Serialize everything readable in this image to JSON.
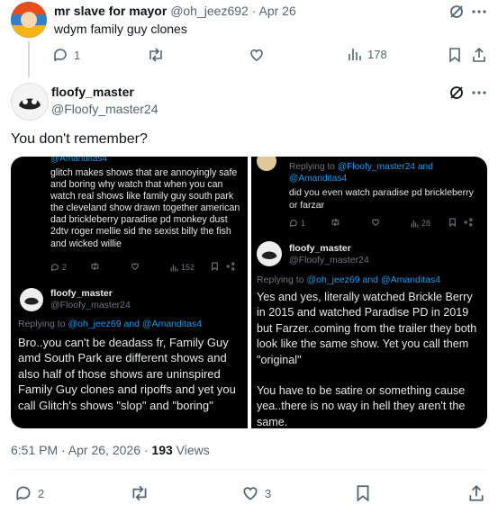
{
  "parent": {
    "display_name": "mr slave for mayor",
    "handle": "@oh_jeez692",
    "date": "Apr 26",
    "text": "wdym family guy clones",
    "replies": "1",
    "views": "178"
  },
  "focal": {
    "display_name": "floofy_master",
    "handle": "@Floofy_master24",
    "text": "You don't remember?",
    "time": "6:51 PM · Apr 26, 2026 · ",
    "views_count": "193",
    "views_label": " Views",
    "replies": "2",
    "likes": "3"
  },
  "left_image": {
    "top_cut": "@Amanditas4",
    "quoted_text": "glitch makes shows that are annoyingly safe and boring why watch that when you can watch real shows like family guy south park the cleveland show drawn together american dad brickleberry paradise pd monkey dust 2dtv roger mellie sid the sexist billy the fish and wicked willie",
    "replies": "2",
    "views": "152",
    "reply_name": "floofy_master",
    "reply_handle": "@Floofy_master24",
    "replying_prefix": "Replying to ",
    "replying_to": "@oh_jeez69 and @Amanditas4",
    "reply_text": "Bro..you can't be deadass fr, Family Guy amd South Park are different shows and also half of those shows are uninspired Family Guy clones and ripoffs and yet you call Glitch's shows \"slop\" and \"boring\""
  },
  "right_image": {
    "replying_prefix": "Replying to ",
    "replying_to": "@Floofy_master24 and @Amanditas4",
    "quoted_text": "did you even watch paradise pd brickleberry or farzar",
    "replies": "1",
    "views": "28",
    "reply_name": "floofy_master",
    "reply_handle": "@Floofy_master24",
    "replying_to_2": "@oh_jeez69 and @Amanditas4",
    "reply_text_1": "Yes and yes, literally watched Brickle Berry in 2015 and watched Paradise PD in 2019 but Farzer..coming from the trailer they both look like the same show. Yet you call them \"original\"",
    "reply_text_2": "You have to be satire or something cause yea..there is no way in hell they aren't the same."
  },
  "colors": {
    "accent": "#1d9bf0",
    "text": "#0f1419",
    "muted": "#536471",
    "dark_bg": "#000000"
  }
}
